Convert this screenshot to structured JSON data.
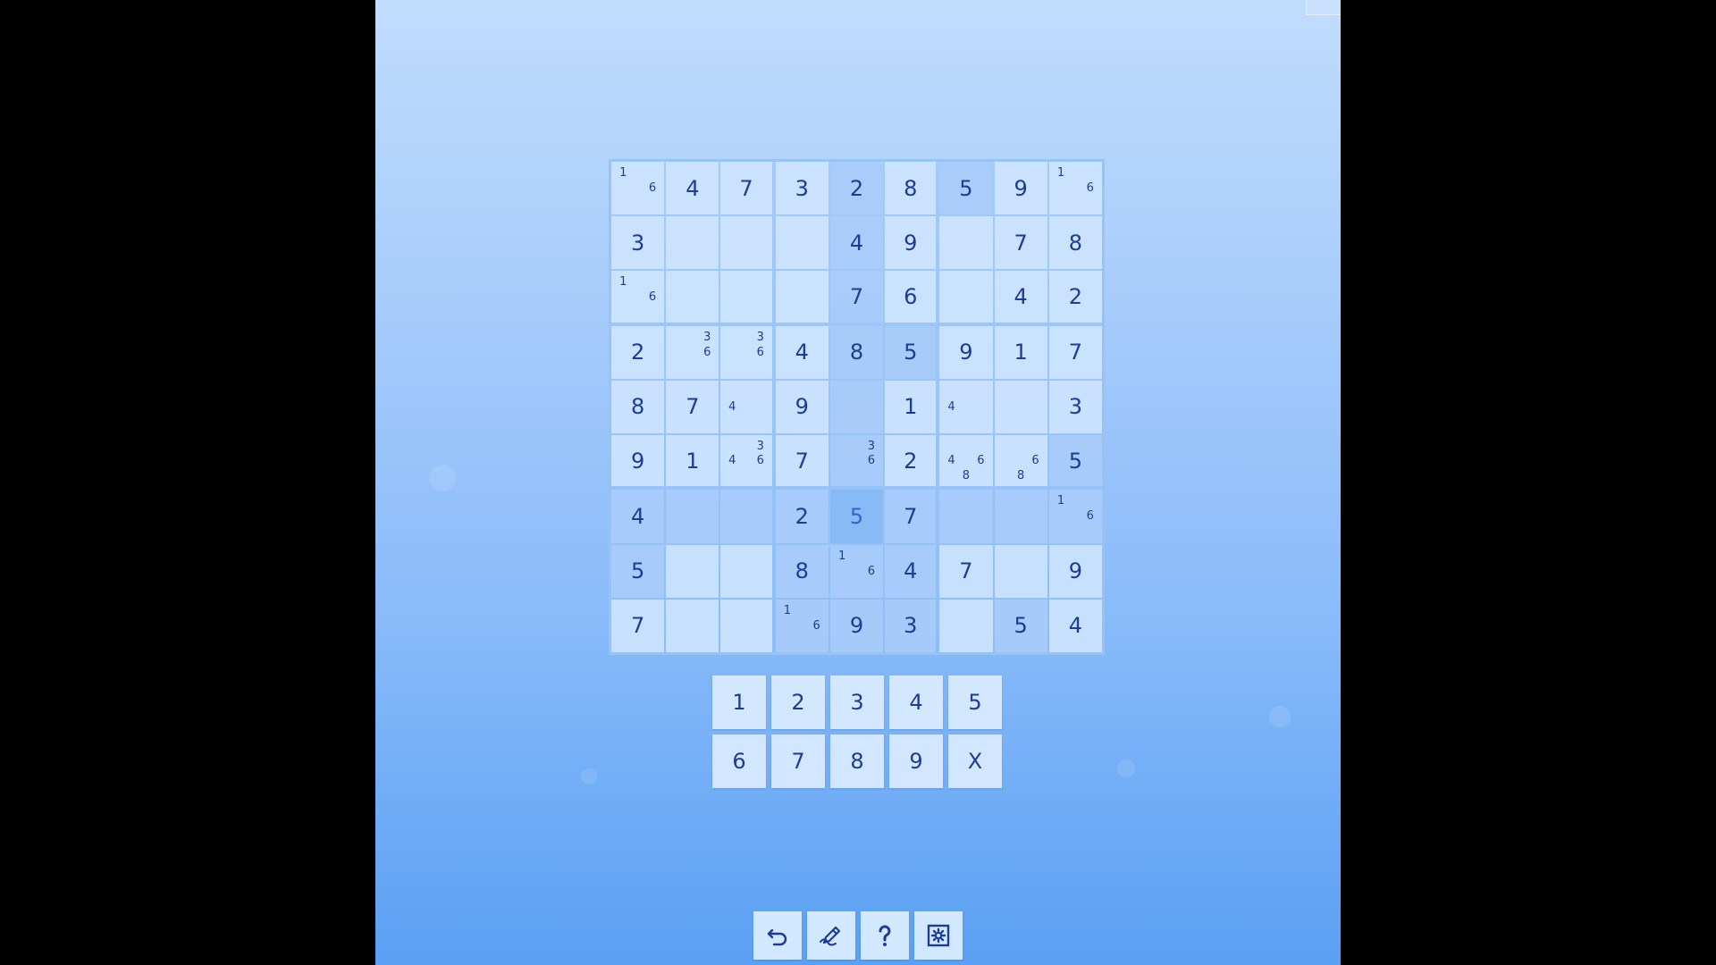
{
  "game": {
    "grid": [
      [
        {
          "n": [
            1,
            6
          ]
        },
        {
          "v": "4"
        },
        {
          "v": "7"
        },
        {
          "v": "3"
        },
        {
          "v": "2"
        },
        {
          "v": "8"
        },
        {
          "v": "5"
        },
        {
          "v": "9"
        },
        {
          "n": [
            1,
            6
          ]
        }
      ],
      [
        {
          "v": "3"
        },
        {},
        {},
        {},
        {
          "v": "4"
        },
        {
          "v": "9"
        },
        {},
        {
          "v": "7"
        },
        {
          "v": "8"
        }
      ],
      [
        {
          "n": [
            1,
            6
          ]
        },
        {},
        {},
        {},
        {
          "v": "7"
        },
        {
          "v": "6"
        },
        {},
        {
          "v": "4"
        },
        {
          "v": "2"
        }
      ],
      [
        {
          "v": "2"
        },
        {
          "n": [
            3,
            6
          ]
        },
        {
          "n": [
            3,
            6
          ]
        },
        {
          "v": "4"
        },
        {
          "v": "8"
        },
        {
          "v": "5"
        },
        {
          "v": "9"
        },
        {
          "v": "1"
        },
        {
          "v": "7"
        }
      ],
      [
        {
          "v": "8"
        },
        {
          "v": "7"
        },
        {
          "n": [
            4
          ]
        },
        {
          "v": "9"
        },
        {},
        {
          "v": "1"
        },
        {
          "n": [
            4
          ]
        },
        {},
        {
          "v": "3"
        }
      ],
      [
        {
          "v": "9"
        },
        {
          "v": "1"
        },
        {
          "n": [
            3,
            4,
            6
          ]
        },
        {
          "v": "7"
        },
        {
          "n": [
            3,
            6
          ]
        },
        {
          "v": "2"
        },
        {
          "n": [
            4,
            6,
            8
          ]
        },
        {
          "n": [
            6,
            8
          ]
        },
        {
          "v": "5"
        }
      ],
      [
        {
          "v": "4"
        },
        {},
        {},
        {
          "v": "2"
        },
        {
          "v": "5"
        },
        {
          "v": "7"
        },
        {},
        {},
        {
          "n": [
            1,
            6
          ]
        }
      ],
      [
        {
          "v": "5"
        },
        {},
        {},
        {
          "v": "8"
        },
        {
          "n": [
            1,
            6
          ]
        },
        {
          "v": "4"
        },
        {
          "v": "7"
        },
        {},
        {
          "v": "9"
        }
      ],
      [
        {
          "v": "7"
        },
        {},
        {},
        {
          "n": [
            1,
            6
          ]
        },
        {
          "v": "9"
        },
        {
          "v": "3"
        },
        {},
        {
          "v": "5"
        },
        {
          "v": "4"
        }
      ]
    ],
    "selected_cell": [
      6,
      4
    ],
    "number_pad": [
      "1",
      "2",
      "3",
      "4",
      "5",
      "6",
      "7",
      "8",
      "9",
      "X"
    ],
    "toolbar": [
      {
        "name": "undo-icon"
      },
      {
        "name": "pencil-icon"
      },
      {
        "name": "help-icon"
      },
      {
        "name": "settings-icon"
      }
    ]
  },
  "colors": {
    "digit": "#1d3c93",
    "highlight": "#aacdfa",
    "selected": "#87b9f5"
  }
}
